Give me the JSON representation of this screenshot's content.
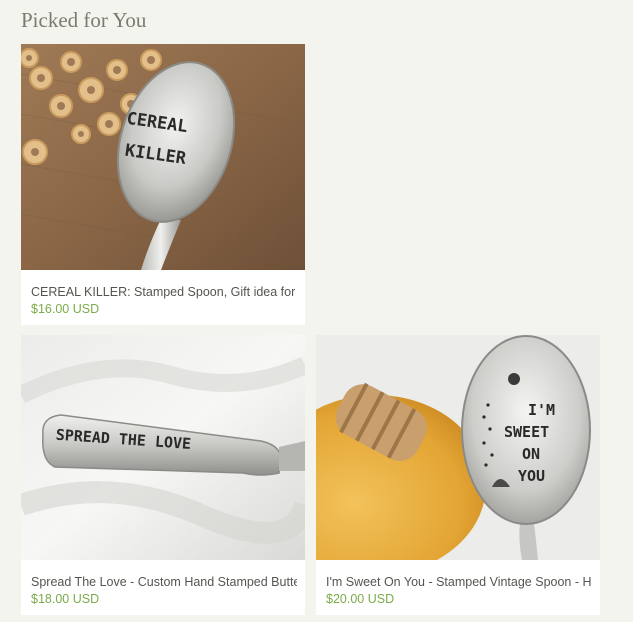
{
  "section": {
    "title": "Picked for You"
  },
  "items": [
    {
      "title": "CEREAL KILLER: Stamped Spoon, Gift idea for",
      "price": "$16.00 USD",
      "stamp_lines": [
        "CEREAL",
        "KILLER"
      ]
    },
    {
      "title": "Spread The Love - Custom Hand Stamped Butter Knife",
      "price": "$18.00 USD",
      "stamp_lines": [
        "SPREAD THE LOVE"
      ]
    },
    {
      "title": "I'm Sweet On You - Stamped Vintage Spoon - Honey",
      "price": "$20.00 USD",
      "stamp_lines": [
        "I'M",
        "SWEET",
        "ON",
        "YOU"
      ]
    }
  ],
  "colors": {
    "background": "#f4f4ef",
    "title_text": "#7a7a72",
    "item_text": "#555550",
    "price": "#7bab4b"
  }
}
